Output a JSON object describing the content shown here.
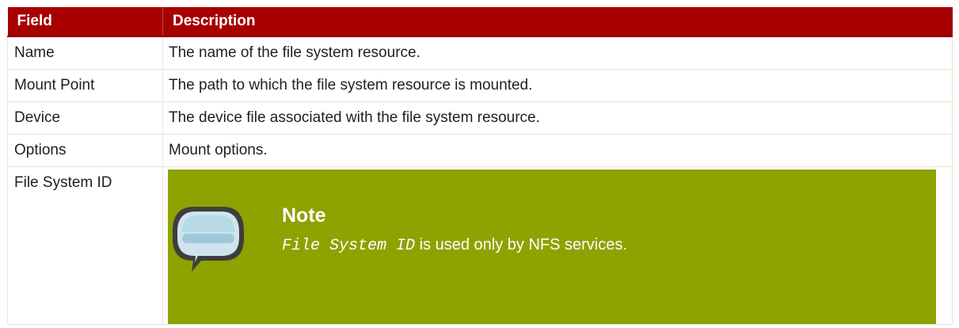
{
  "table": {
    "headers": {
      "field": "Field",
      "description": "Description"
    },
    "rows": [
      {
        "field": "Name",
        "description": "The name of the file system resource."
      },
      {
        "field": "Mount Point",
        "description": "The path to which the file system resource is mounted."
      },
      {
        "field": "Device",
        "description": "The device file associated with the file system resource."
      },
      {
        "field": "Options",
        "description": "Mount options."
      },
      {
        "field": "File System ID",
        "note": {
          "title": "Note",
          "code": "File System ID",
          "text": " is used only by NFS services.",
          "icon": "speech-bubble-icon"
        }
      }
    ]
  },
  "colors": {
    "header_bg": "#a70000",
    "note_bg": "#8ea200",
    "row_border": "#ede3cf"
  }
}
